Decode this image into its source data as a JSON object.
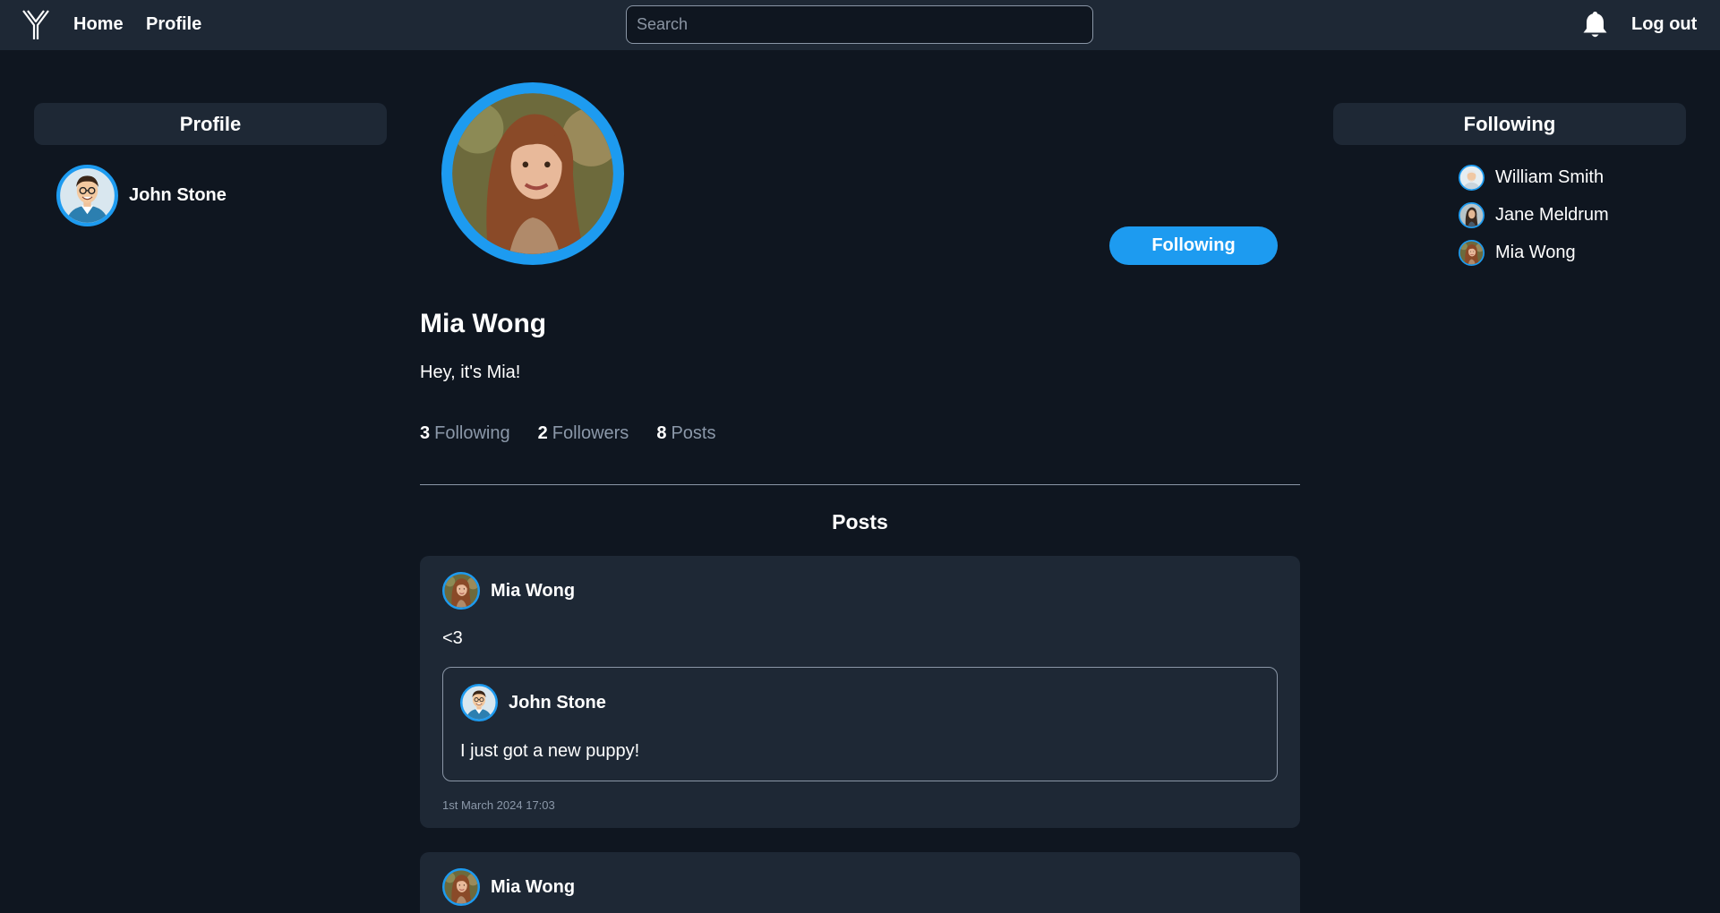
{
  "nav": {
    "home_label": "Home",
    "profile_label": "Profile",
    "search_placeholder": "Search",
    "search_value": "",
    "logout_label": "Log out"
  },
  "left_panel": {
    "title": "Profile",
    "user_name": "John Stone"
  },
  "right_panel": {
    "title": "Following",
    "items": [
      {
        "name": "William Smith"
      },
      {
        "name": "Jane Meldrum"
      },
      {
        "name": "Mia Wong"
      }
    ]
  },
  "profile": {
    "name": "Mia Wong",
    "bio": "Hey, it's Mia!",
    "follow_button_label": "Following",
    "stats": {
      "following_count": "3",
      "following_label": "Following",
      "followers_count": "2",
      "followers_label": "Followers",
      "posts_count": "8",
      "posts_label": "Posts"
    }
  },
  "posts_heading": "Posts",
  "posts": [
    {
      "author": "Mia Wong",
      "text": "<3",
      "quoted": {
        "author": "John Stone",
        "text": "I just got a new puppy!"
      },
      "timestamp": "1st March 2024 17:03"
    },
    {
      "author": "Mia Wong"
    }
  ],
  "colors": {
    "background": "#0f1620",
    "surface": "#1e2835",
    "accent": "#1d9bf0",
    "muted_text": "#8b98a9"
  },
  "icons": {
    "logo": "y-logo-icon",
    "notifications": "bell-icon"
  }
}
